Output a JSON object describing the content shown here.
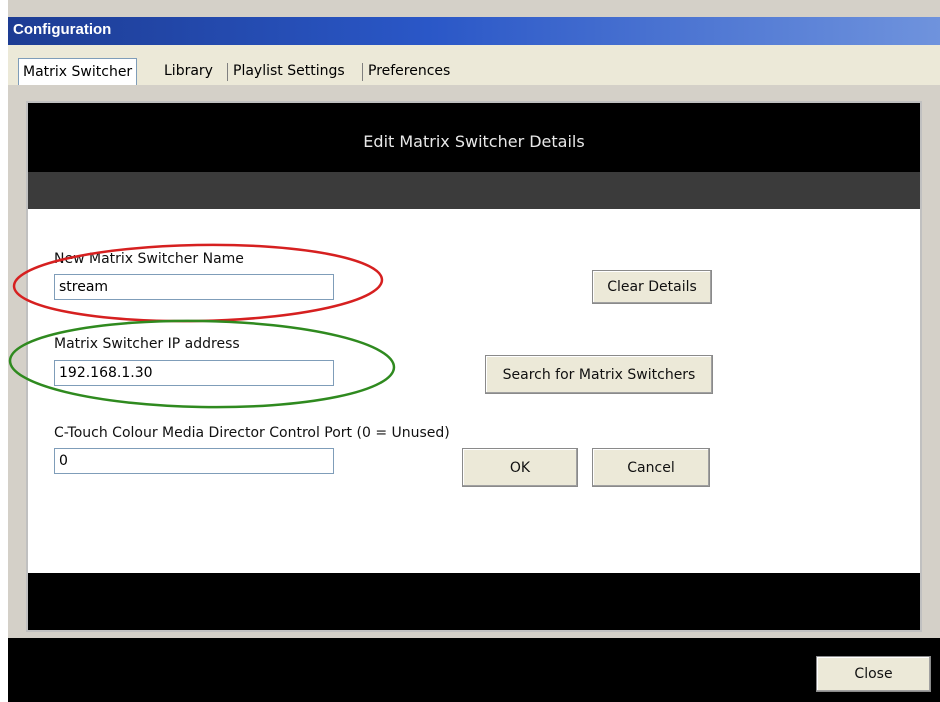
{
  "window": {
    "title": "Configuration"
  },
  "tabs": [
    {
      "label": "Matrix Switcher",
      "active": true
    },
    {
      "label": "Library",
      "active": false
    },
    {
      "label": "Playlist Settings",
      "active": false
    },
    {
      "label": "Preferences",
      "active": false
    }
  ],
  "panel": {
    "heading": "Edit Matrix Switcher Details"
  },
  "form": {
    "name_label": "New Matrix Switcher Name",
    "name_value": "stream",
    "ip_label": "Matrix Switcher IP address",
    "ip_value": "192.168.1.30",
    "port_label": "C-Touch Colour Media Director Control Port (0 = Unused)",
    "port_value": "0"
  },
  "buttons": {
    "clear": "Clear Details",
    "search": "Search for Matrix Switchers",
    "ok": "OK",
    "cancel": "Cancel",
    "close": "Close"
  },
  "colors": {
    "highlight_name": "#d62020",
    "highlight_ip": "#2f8a1f",
    "title_bar": "#2a57c7"
  }
}
